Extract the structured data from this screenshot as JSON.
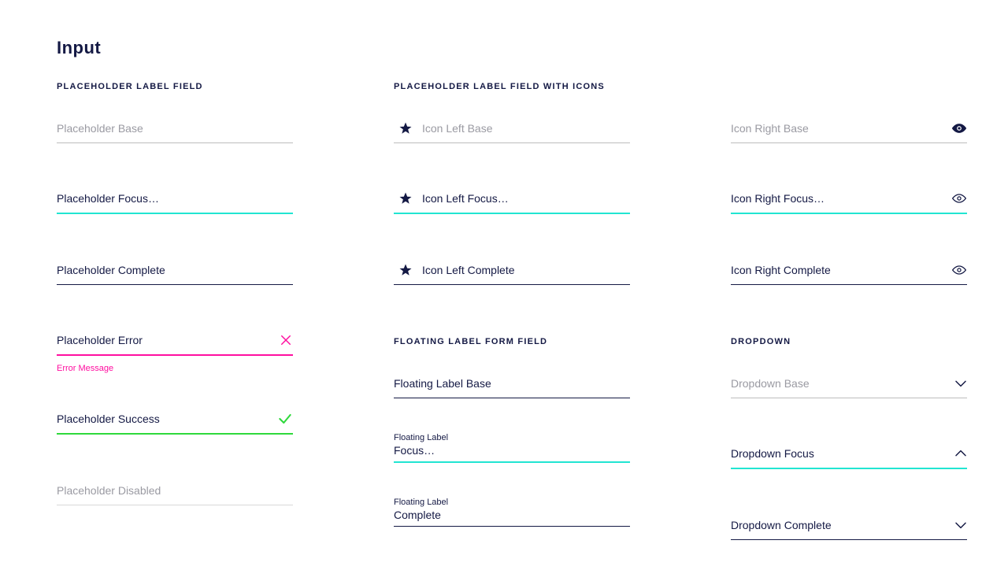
{
  "title": "Input",
  "sections": {
    "placeholder": {
      "label": "PLACEHOLDER LABEL FIELD",
      "base": "Placeholder Base",
      "focus": "Placeholder Focus…",
      "complete": "Placeholder Complete",
      "error": "Placeholder Error",
      "errorMsg": "Error Message",
      "success": "Placeholder Success",
      "disabled": "Placeholder Disabled"
    },
    "icons": {
      "label": "PLACEHOLDER LABEL FIELD WITH ICONS",
      "left": {
        "base": "Icon Left Base",
        "focus": "Icon Left Focus…",
        "complete": "Icon Left Complete"
      },
      "right": {
        "base": "Icon Right Base",
        "focus": "Icon Right Focus…",
        "complete": "Icon Right Complete"
      }
    },
    "floating": {
      "label": "FLOATING LABEL FORM FIELD",
      "base": "Floating Label Base",
      "floatLabel": "Floating Label",
      "focus": "Focus…",
      "complete": "Complete"
    },
    "dropdown": {
      "label": "DROPDOWN",
      "base": "Dropdown Base",
      "focus": "Dropdown Focus",
      "complete": "Dropdown Complete"
    }
  }
}
